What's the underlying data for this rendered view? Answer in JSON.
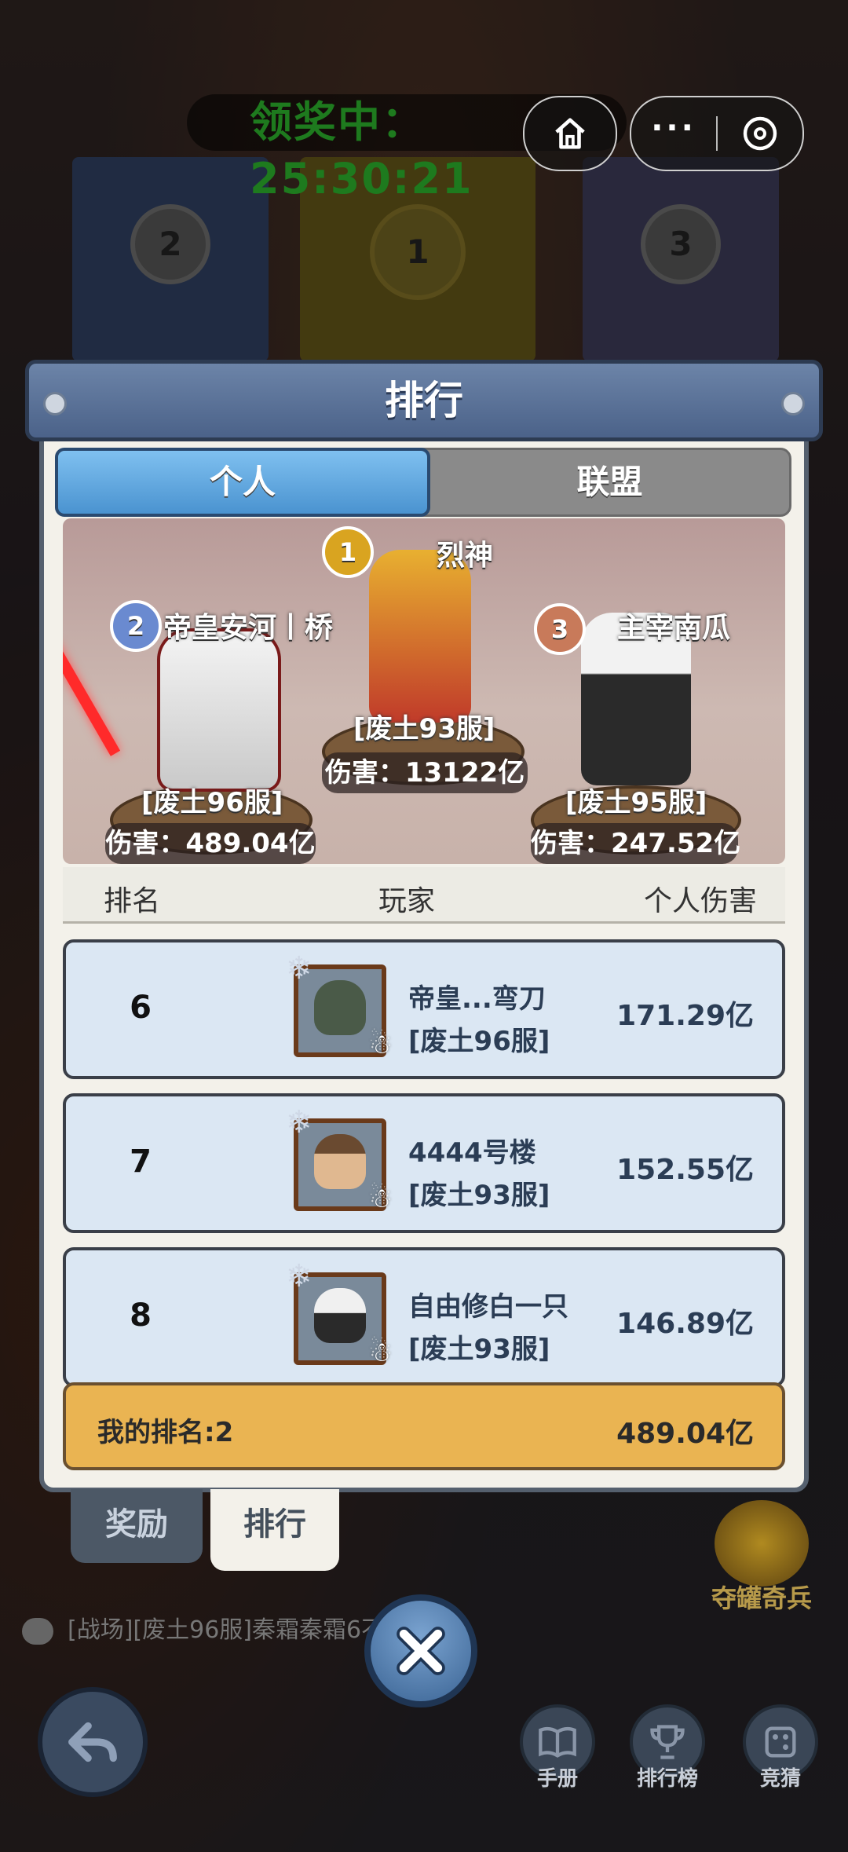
{
  "top": {
    "timer_text": "领奖中：25:30:21"
  },
  "banners": {
    "left_rank": "2",
    "center_rank": "1",
    "right_rank": "3"
  },
  "panel": {
    "title": "排行",
    "tabs": [
      {
        "label": "个人",
        "active": true
      },
      {
        "label": "联盟",
        "active": false
      }
    ]
  },
  "podium": {
    "first": {
      "rank": "1",
      "name": "烈神",
      "server": "[废土93服]",
      "damage": "伤害：13122亿"
    },
    "second": {
      "rank": "2",
      "name": "帝皇安河丨桥",
      "server": "[废土96服]",
      "damage": "伤害：489.04亿"
    },
    "third": {
      "rank": "3",
      "name": "主宰南瓜",
      "server": "[废土95服]",
      "damage": "伤害：247.52亿"
    }
  },
  "table": {
    "headers": [
      "排名",
      "玩家",
      "个人伤害"
    ],
    "rows": [
      {
        "rank": "6",
        "name": "帝皇...弯刀",
        "server": "[废土96服]",
        "damage": "171.29亿"
      },
      {
        "rank": "7",
        "name": "4444号楼",
        "server": "[废土93服]",
        "damage": "152.55亿"
      },
      {
        "rank": "8",
        "name": "自由修白一只",
        "server": "[废土93服]",
        "damage": "146.89亿"
      }
    ]
  },
  "my_rank": {
    "label": "我的排名:2",
    "damage": "489.04亿"
  },
  "bottom_tabs": {
    "reward": "奖励",
    "rank": "排行"
  },
  "chat": {
    "text": "[战场][废土96服]秦霜秦霜6不在..."
  },
  "side_promo": {
    "label": "夺罐奇兵"
  },
  "nav": {
    "manual": "手册",
    "leaderboard": "排行榜",
    "guess": "竞猜"
  },
  "colors": {
    "accent_blue": "#4a93d0",
    "my_rank_bg": "#eab452",
    "row_bg": "#dbe7f3",
    "timer_green": "#1e7a1e"
  }
}
